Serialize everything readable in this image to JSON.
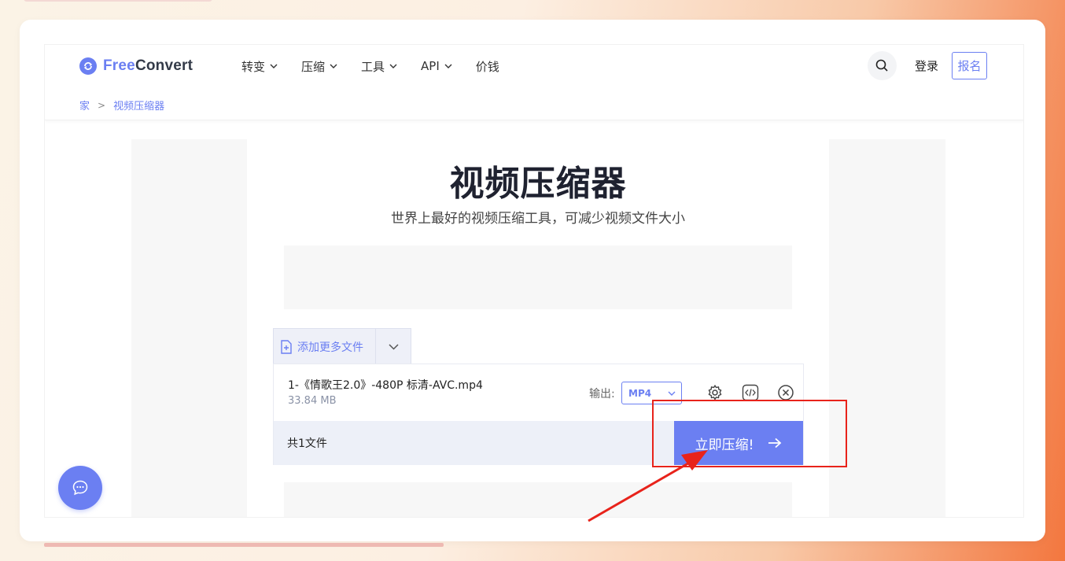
{
  "brand": {
    "free": "Free",
    "convert": "Convert"
  },
  "nav": [
    {
      "label": "转变"
    },
    {
      "label": "压缩"
    },
    {
      "label": "工具"
    },
    {
      "label": "API"
    },
    {
      "label": "价钱"
    }
  ],
  "header": {
    "login": "登录",
    "signup": "报名"
  },
  "breadcrumb": {
    "home": "家",
    "current": "视频压缩器"
  },
  "main": {
    "title": "视频压缩器",
    "subtitle": "世界上最好的视频压缩工具，可减少视频文件大小"
  },
  "uploader": {
    "add_more": "添加更多文件",
    "file": {
      "name": "1-《情歌王2.0》-480P 标清-AVC.mp4",
      "size": "33.84 MB",
      "output_label": "输出:",
      "output_format": "MP4"
    },
    "file_count": "共1文件",
    "compress_label": "立即压缩!"
  },
  "colors": {
    "accent": "#6b7ff2",
    "annotation": "#e8231b"
  },
  "icons": [
    "search-icon",
    "chevron-down-icon",
    "add-file-icon",
    "gear-icon",
    "code-icon",
    "close-circle-icon",
    "arrow-right-icon",
    "chat-icon",
    "logo-icon"
  ]
}
